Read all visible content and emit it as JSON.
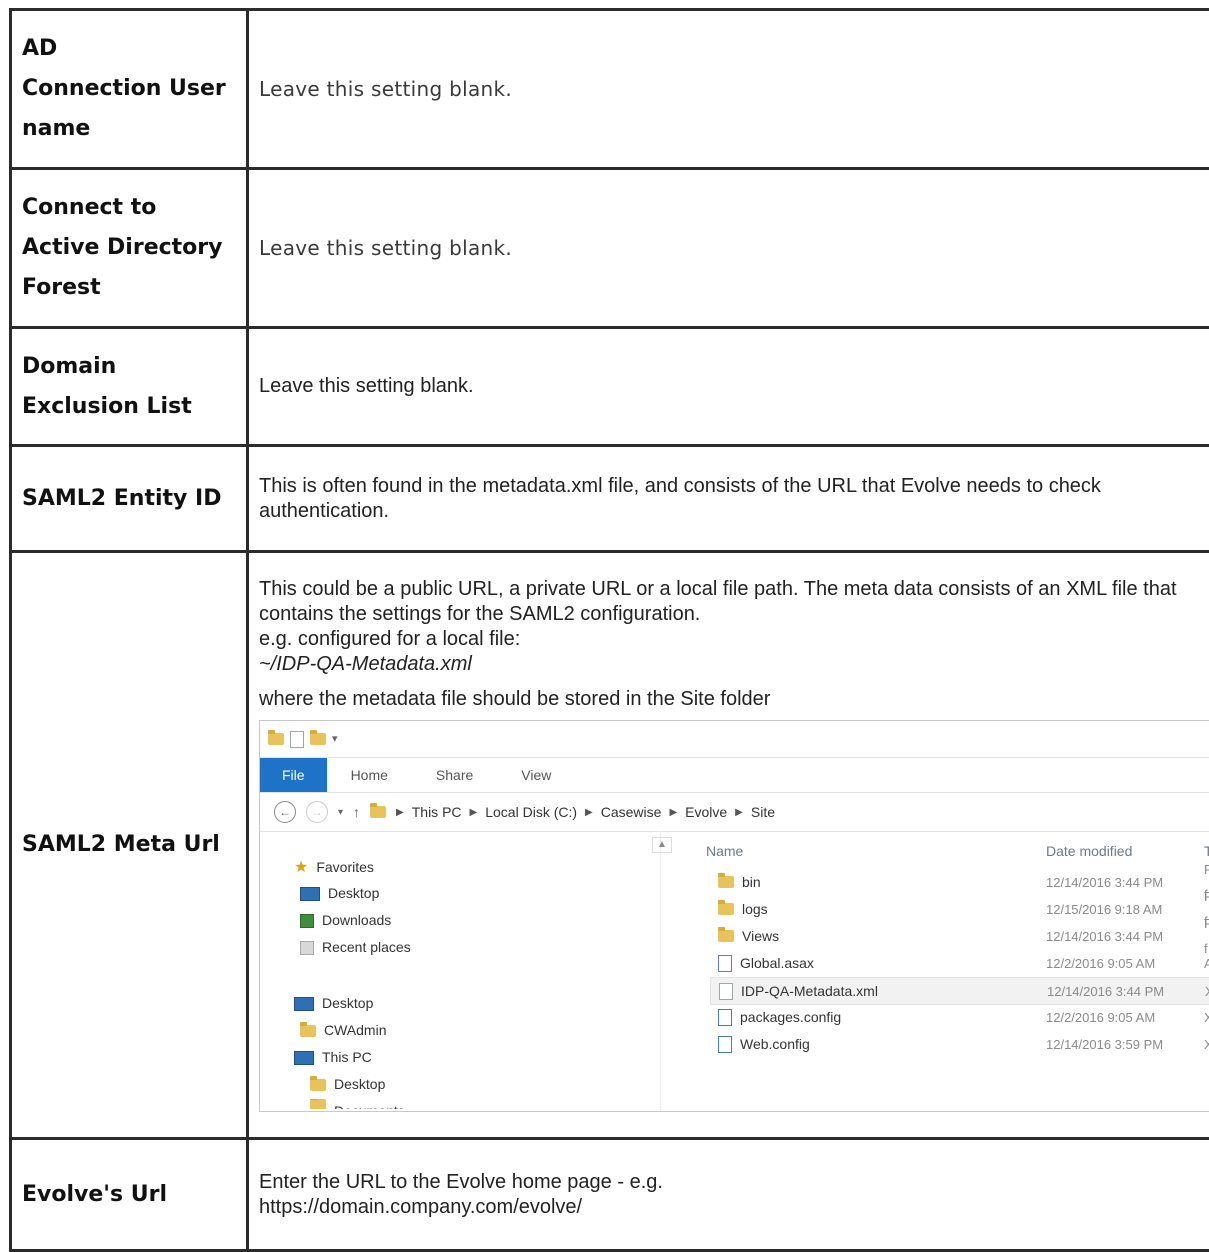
{
  "rows": [
    {
      "label_lines": [
        "AD",
        "Connection User",
        "name"
      ],
      "desc": "Leave this setting blank."
    },
    {
      "label_lines": [
        "Connect to",
        "Active Directory",
        "Forest"
      ],
      "desc": "Leave this setting blank."
    },
    {
      "label_lines": [
        "Domain",
        "Exclusion List"
      ],
      "desc": "Leave this setting blank."
    },
    {
      "label_lines": [
        "SAML2 Entity ID"
      ],
      "desc": "This is often found in the metadata.xml file, and consists of the URL that Evolve needs to check authentication."
    },
    {
      "label_lines": [
        "SAML2 Meta Url"
      ],
      "desc_lines": [
        "This could be a public URL, a private URL or a local file path. The meta data consists of an XML file that contains the settings for the SAML2 configuration.",
        "e.g. configured for a local file:"
      ],
      "example_path": "~/IDP-QA-Metadata.xml",
      "after_text": "where the metadata file should be stored in the Site folder"
    },
    {
      "label_lines": [
        "Evolve's Url"
      ],
      "desc_lines": [
        "Enter the URL to the Evolve home page - e.g.",
        "https://domain.company.com/evolve/"
      ]
    }
  ],
  "explorer": {
    "qat_arrow": "▾",
    "ribbon_tabs": [
      "File",
      "Home",
      "Share",
      "View"
    ],
    "nav": {
      "back": "←",
      "forward": "→",
      "dropdown": "▾",
      "up": "↑"
    },
    "breadcrumb": [
      "This PC",
      "Local Disk (C:)",
      "Casewise",
      "Evolve",
      "Site"
    ],
    "sidebar": [
      {
        "label": "Favorites",
        "icon": "star-icon"
      },
      {
        "label": "Desktop",
        "icon": "desktop-icon"
      },
      {
        "label": "Downloads",
        "icon": "downloads-icon"
      },
      {
        "label": "Recent places",
        "icon": "recent-places-icon"
      },
      {
        "label": "Desktop",
        "icon": "desktop-icon"
      },
      {
        "label": "CWAdmin",
        "icon": "user-folder-icon"
      },
      {
        "label": "This PC",
        "icon": "pc-icon"
      },
      {
        "label": "Desktop",
        "icon": "desktop-folder-icon"
      },
      {
        "label": "Documents",
        "icon": "documents-icon"
      }
    ],
    "columns": {
      "name": "Name",
      "date": "Date modified",
      "type": "Type"
    },
    "files": [
      {
        "name": "bin",
        "date": "12/14/2016 3:44 PM",
        "type": "File f",
        "icon": "folder-icon"
      },
      {
        "name": "logs",
        "date": "12/15/2016 9:18 AM",
        "type": "File f",
        "icon": "folder-icon"
      },
      {
        "name": "Views",
        "date": "12/14/2016 3:44 PM",
        "type": "File f",
        "icon": "folder-icon"
      },
      {
        "name": "Global.asax",
        "date": "12/2/2016 9:05 AM",
        "type": "ASP.",
        "icon": "asax-file-icon"
      },
      {
        "name": "IDP-QA-Metadata.xml",
        "date": "12/14/2016 3:44 PM",
        "type": "XML",
        "icon": "xml-file-icon",
        "selected": true
      },
      {
        "name": "packages.config",
        "date": "12/2/2016 9:05 AM",
        "type": "XML",
        "icon": "config-file-icon"
      },
      {
        "name": "Web.config",
        "date": "12/14/2016 3:59 PM",
        "type": "XML",
        "icon": "config-file-icon"
      }
    ]
  }
}
